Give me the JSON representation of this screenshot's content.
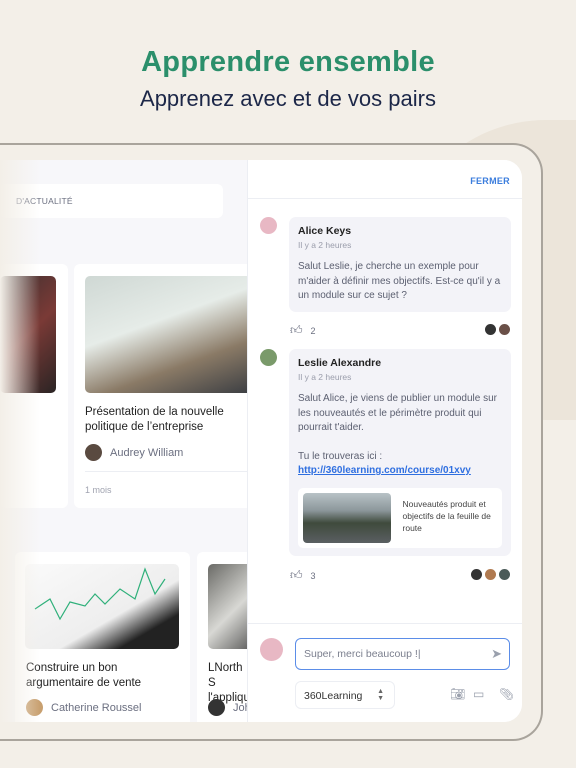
{
  "header": {
    "title": "Apprendre ensemble",
    "subtitle": "Apprenez avec et de vos pairs"
  },
  "feed": {
    "newsbar_label": "D'ACTUALITÉ",
    "cards": [
      {
        "title": "Présentation de la nouvelle politique de l’entreprise",
        "author": "Audrey William",
        "age": "1 mois"
      },
      {
        "title": "Construire un bon argumentaire de vente",
        "author": "Catherine Roussel"
      },
      {
        "title": "LNorth S l'appliqu",
        "author": "Joh"
      }
    ]
  },
  "chat": {
    "close_label": "FERMER",
    "messages": [
      {
        "author": "Alice Keys",
        "time": "Il y a 2 heures",
        "text": "Salut Leslie, je cherche un exemple pour m'aider à définir mes objectifs. Est-ce qu'il y a un module sur ce sujet ?",
        "likes": "2"
      },
      {
        "author": "Leslie Alexandre",
        "time": "Il y a 2 heures",
        "text": "Salut Alice, je viens de publier un module sur les nouveautés et le périmètre produit qui pourrait t'aider.",
        "text2": "Tu le trouveras ici :",
        "link": "http://360learning.com/course/01xvy",
        "preview_title": "Nouveautés produit et objectifs de la feuille de route",
        "likes": "3"
      }
    ],
    "input_value": "Super, merci beaucoup !|",
    "group_select": "360Learning",
    "icons": [
      "thumbs-up-icon",
      "send-icon",
      "camera-icon",
      "video-icon",
      "paperclip-icon"
    ],
    "accent": "#3b7ddd"
  },
  "colors": {
    "title": "#2b8f6b",
    "subtitle": "#1c2748",
    "background": "#f3efe8"
  }
}
